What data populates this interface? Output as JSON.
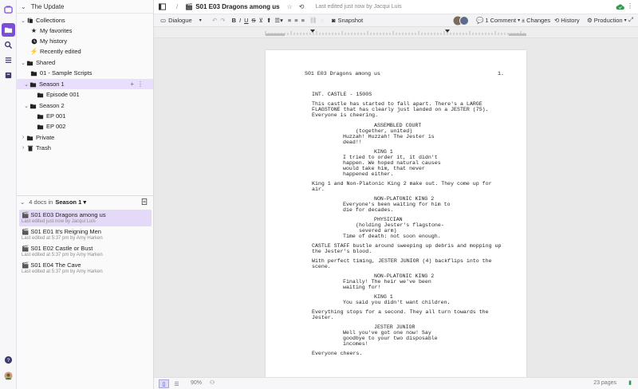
{
  "sidebar": {
    "title": "The Update",
    "collections_label": "Collections",
    "my_favorites": "My favorites",
    "my_history": "My history",
    "recently_edited": "Recently edited",
    "shared_label": "Shared",
    "sample_scripts": "01 - Sample Scripts",
    "season1": "Season 1",
    "episode001": "Episode 001",
    "season2": "Season 2",
    "ep001": "EP 001",
    "ep002": "EP 002",
    "private_label": "Private",
    "trash_label": "Trash"
  },
  "docs_panel": {
    "count_text": "4 docs in",
    "folder": "Season 1",
    "items": [
      {
        "title": "S01 E03 Dragons among us",
        "sub": "Last edited just now by Jacqui Luis"
      },
      {
        "title": "S01 E01 It's Reigning Men",
        "sub": "Last edited at 5:37 pm by Amy Harken"
      },
      {
        "title": "S01 E02 Castle or Bust",
        "sub": "Last edited at 5:37 pm by Amy Harken"
      },
      {
        "title": "S01 E04 The Cave",
        "sub": "Last edited at 5:37 pm by Amy Harken"
      }
    ]
  },
  "topbar": {
    "separator": "/",
    "doc_title": "S01 E03 Dragons among us",
    "last_edited": "Last edited just now by Jacqui Luis"
  },
  "toolbar": {
    "element_type": "Dialogue",
    "bold": "B",
    "italic": "I",
    "underline": "U",
    "strike": "S",
    "snapshot": "Snapshot",
    "comment": "1 Comment",
    "changes": "Changes",
    "history": "History",
    "production": "Production"
  },
  "script": {
    "header_title": "S01 E03 Dragons among us",
    "page_num": "1.",
    "lines": [
      "INT. CASTLE - 1500S",
      "This castle has started to fall apart. There's a LARGE",
      "FLAGSTONE that has clearly just landed on a JESTER (75).",
      "Everyone is cheering.",
      "ASSEMBLED COURT",
      "(together, united)",
      "Huzzah! Huzzah! The Jester is",
      "dead!!",
      "KING 1",
      "I tried to order it, it didn't",
      "happen. We hoped natural causes",
      "would take him, that never",
      "happened either.",
      "King 1 and Non-Platonic King 2 make out. They come up for",
      "air.",
      "NON-PLATONIC KING 2",
      "Everyone's been waiting for him to",
      "die for decades.",
      "PHYSICIAN",
      "(holding Jester's flagstone-",
      "severed arm)",
      "Time of death: not soon enough.",
      "CASTLE STAFF bustle around sweeping up debris and mopping up",
      "the Jester's blood.",
      "With perfect timing, JESTER JUNIOR (4) backflips into the",
      "scene.",
      "NON-PLATONIC KING 2",
      "Finally! The heir we've been",
      "waiting for!",
      "KING 1",
      "You said you didn't want children.",
      "Everything stops for a second. They all turn towards the",
      "Jester.",
      "JESTER JUNIOR",
      "Well you've got one now! Say",
      "goodbye to your two disposable",
      "incomes!",
      "Everyone cheers."
    ]
  },
  "statusbar": {
    "zoom": "90%",
    "pages": "23 pages"
  },
  "colors": {
    "accent": "#7a4fd6",
    "selected_row": "#e9defc",
    "cloud_ok": "#2e9b4f"
  }
}
